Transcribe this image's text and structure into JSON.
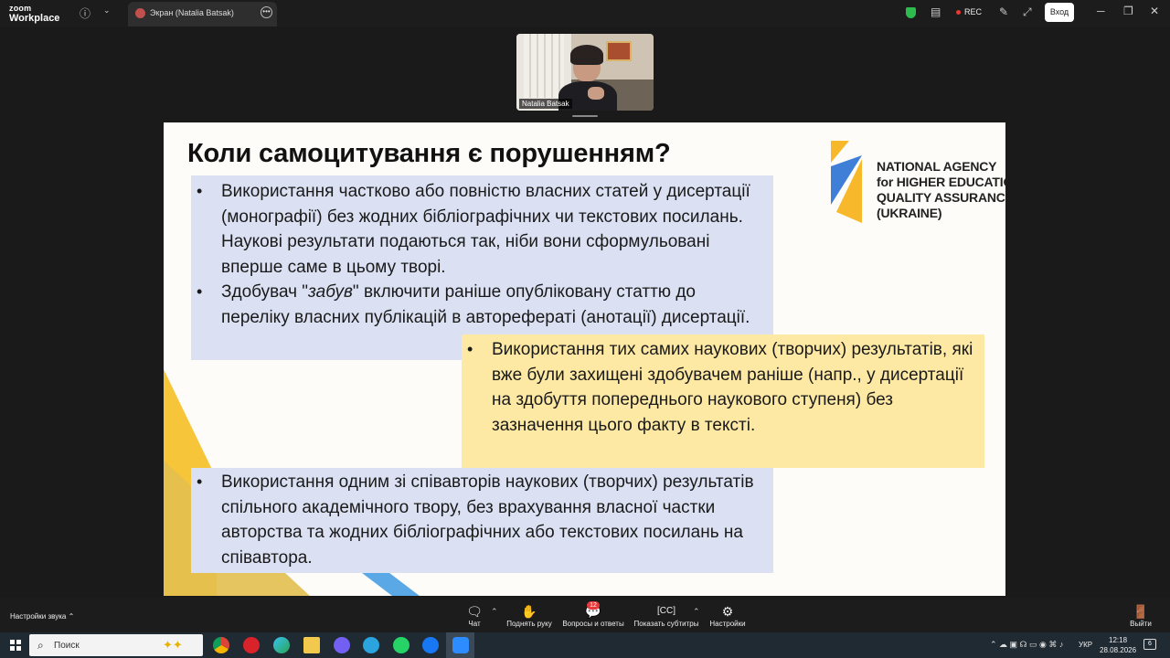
{
  "app": {
    "logo_line1": "zoom",
    "logo_line2": "Workplace"
  },
  "tab": {
    "label": "Экран (Natalia Batsak)"
  },
  "header": {
    "rec_label": "REC",
    "login_label": "Вход"
  },
  "participant": {
    "name": "Natalia Batsak"
  },
  "slide": {
    "title": "Коли самоцитування є порушенням?",
    "logo_lines": [
      "NATIONAL AGENCY",
      "for HIGHER EDUCATION",
      "QUALITY ASSURANCE",
      "(UKRAINE)"
    ],
    "card1": {
      "bullet1": "Використання частково або повністю власних статей у дисертації (монографії) без жодних бібліографічних чи текстових посилань. Наукові результати подаються так, ніби вони сформульовані вперше саме в цьому творі.",
      "bullet2_before": "Здобувач \"",
      "bullet2_italic": "забув",
      "bullet2_after": "\" включити раніше опубліковану статтю до переліку власних публікацій в авторефераті (анотації) дисертації."
    },
    "card2": {
      "bullet": "Використання тих самих наукових (творчих) результатів, які вже були захищені здобувачем раніше (напр., у дисертації на здобуття попереднього наукового ступеня) без зазначення цього факту в тексті."
    },
    "card3": {
      "bullet": "Використання одним зі співавторів наукових (творчих) результатів спільного академічного твору, без врахування власної частки авторства та жодних бібліографічних або текстових посилань на співавтора."
    },
    "colors": {
      "blue_card": "#dbe1f3",
      "yellow_card": "#fde9a4",
      "logo_yellow": "#f7b82b",
      "logo_blue": "#3f7fd8"
    }
  },
  "toolbar": {
    "audio_settings": "Настройки звука",
    "chat": "Чат",
    "raise_hand": "Поднять руку",
    "qa": "Вопросы и ответы",
    "qa_badge": "12",
    "captions": "Показать субтитры",
    "settings": "Настройки",
    "leave": "Выйти"
  },
  "taskbar": {
    "search_placeholder": "Поиск",
    "lang": "УКР",
    "time": "12:18",
    "date": "28.08.2026",
    "notifications": "6"
  }
}
